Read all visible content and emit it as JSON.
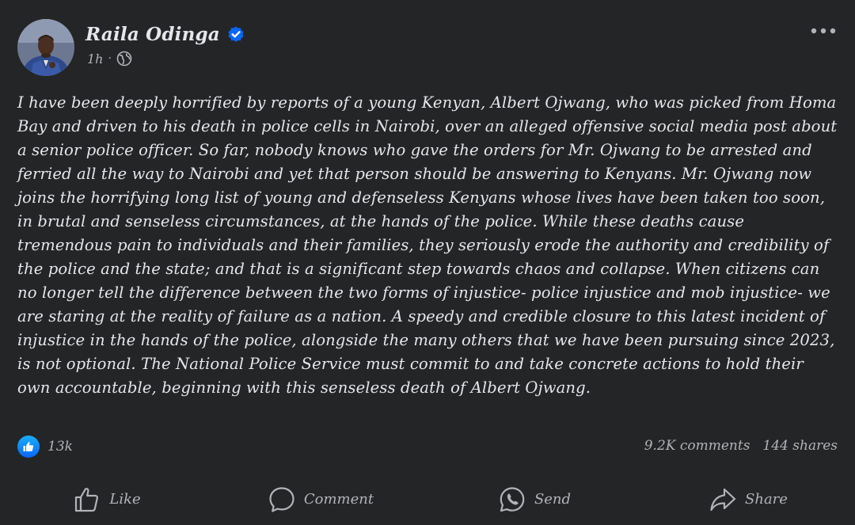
{
  "author": {
    "name": "Raila Odinga",
    "verified_icon": "verified-badge-icon",
    "timestamp": "1h",
    "separator": "·",
    "audience_icon": "globe-icon"
  },
  "menu": {
    "more_icon": "more-horizontal-icon"
  },
  "post": {
    "text": "I have been deeply horrified by reports of a young Kenyan, Albert Ojwang, who was picked from Homa Bay and driven to his death in police cells in Nairobi, over an alleged offensive social media post about a senior police officer. So far, nobody knows who gave the orders for Mr. Ojwang to be arrested and ferried all the way to Nairobi and yet that person should be answering to Kenyans. Mr. Ojwang now joins the horrifying long list of young and defenseless Kenyans whose lives have been taken too soon, in brutal and senseless circumstances, at the hands of the police. While these deaths cause tremendous pain to individuals and their families, they seriously erode the authority and credibility of the police and the state; and that is a significant step towards chaos and collapse. When citizens can no longer tell the difference between the two forms of injustice- police injustice and mob injustice- we are staring at the reality of failure as a nation. A speedy and credible closure to this latest incident of injustice in the hands of the police, alongside the many others that we have been pursuing since 2023, is not optional. The National Police Service must commit to and take concrete actions to hold their own accountable, beginning with this senseless death of Albert Ojwang."
  },
  "engagement": {
    "reaction_count": "13k",
    "comments": "9.2K comments",
    "shares": "144 shares"
  },
  "actions": [
    {
      "label": "Like",
      "icon": "thumbs-up-icon"
    },
    {
      "label": "Comment",
      "icon": "comment-bubble-icon"
    },
    {
      "label": "Send",
      "icon": "whatsapp-icon"
    },
    {
      "label": "Share",
      "icon": "share-arrow-icon"
    }
  ],
  "colors": {
    "background": "#242526",
    "text_primary": "#e4e6eb",
    "text_secondary": "#b0b3b8",
    "verified_blue": "#0866ff",
    "like_blue": "#0866ff"
  }
}
